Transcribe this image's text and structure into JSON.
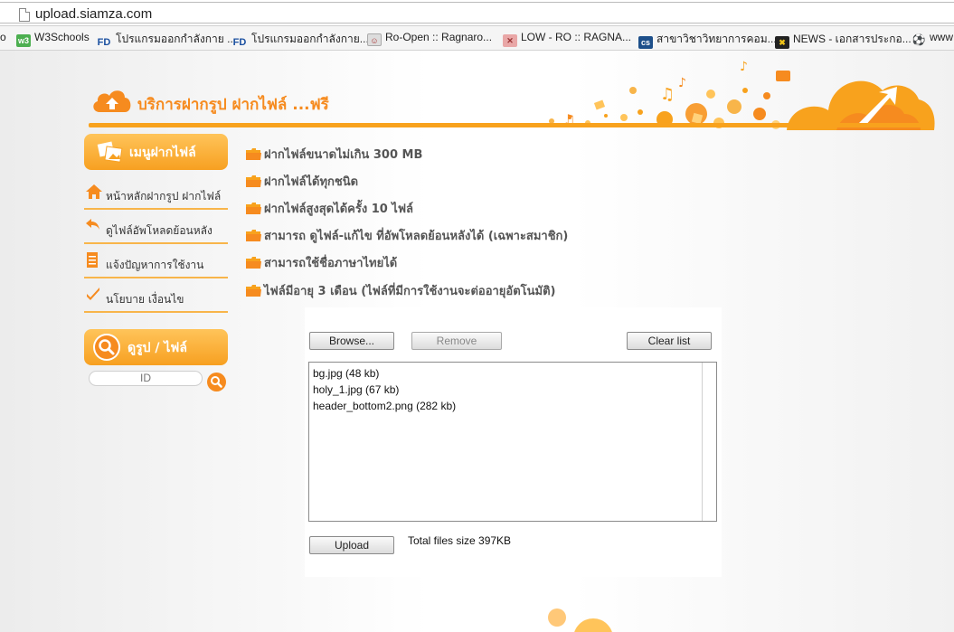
{
  "browser": {
    "url": "upload.siamza.com",
    "bookmarks": [
      {
        "icon": "w3schools-icon",
        "label": "W3Schools"
      },
      {
        "icon": "fd-icon",
        "label": "โปรแกรมออกกำลังกาย ..."
      },
      {
        "icon": "fd-icon",
        "label": "โปรแกรมออกกำลังกาย..."
      },
      {
        "icon": "ro-icon",
        "label": "Ro-Open :: Ragnaro..."
      },
      {
        "icon": "low-ro-icon",
        "label": "LOW - RO :: RAGNA..."
      },
      {
        "icon": "cs-icon",
        "label": "สาขาวิชาวิทยาการคอม..."
      },
      {
        "icon": "news-icon",
        "label": "NEWS - เอกสารประกอ..."
      },
      {
        "icon": "globe-icon",
        "label": "www"
      }
    ],
    "first_bookmark_prefix": "o"
  },
  "header": {
    "title": "บริการฝากรูป ฝากไฟล์ ...ฟรี"
  },
  "sidebar": {
    "menu_title": "เมนูฝากไฟล์",
    "items": [
      {
        "icon": "home-icon",
        "label": "หน้าหลักฝากรูป ฝากไฟล์"
      },
      {
        "icon": "back-arrow-icon",
        "label": "ดูไฟล์อัพโหลดย้อนหลัง"
      },
      {
        "icon": "report-icon",
        "label": "แจ้งปัญหาการใช้งาน"
      },
      {
        "icon": "check-icon",
        "label": "นโยบาย เงื่อนไข"
      }
    ],
    "search_title": "ดูรูป / ไฟล์",
    "search_placeholder": "ID"
  },
  "features": [
    "ฝากไฟล์ขนาดไม่เกิน 300 MB",
    "ฝากไฟล์ได้ทุกชนิด",
    "ฝากไฟล์สูงสุดได้ครั้ง 10 ไฟล์",
    "สามารถ ดูไฟล์-แก้ไข ที่อัพโหลดย้อนหลังได้ (เฉพาะสมาชิก)",
    "สามารถใช้ชื่อภาษาไทยได้",
    "ไฟล์มีอายุ 3 เดือน (ไฟล์ที่มีการใช้งานจะต่ออายุอัตโนมัติ)"
  ],
  "uploader": {
    "browse_label": "Browse...",
    "remove_label": "Remove",
    "clear_label": "Clear list",
    "upload_label": "Upload",
    "files": [
      "bg.jpg (48 kb)",
      "holy_1.jpg (67 kb)",
      "header_bottom2.png (282 kb)"
    ],
    "total_text": "Total files size 397KB"
  },
  "colors": {
    "accent": "#f68b1f",
    "accent_light": "#ffc45a",
    "divider": "#f8b54a"
  }
}
